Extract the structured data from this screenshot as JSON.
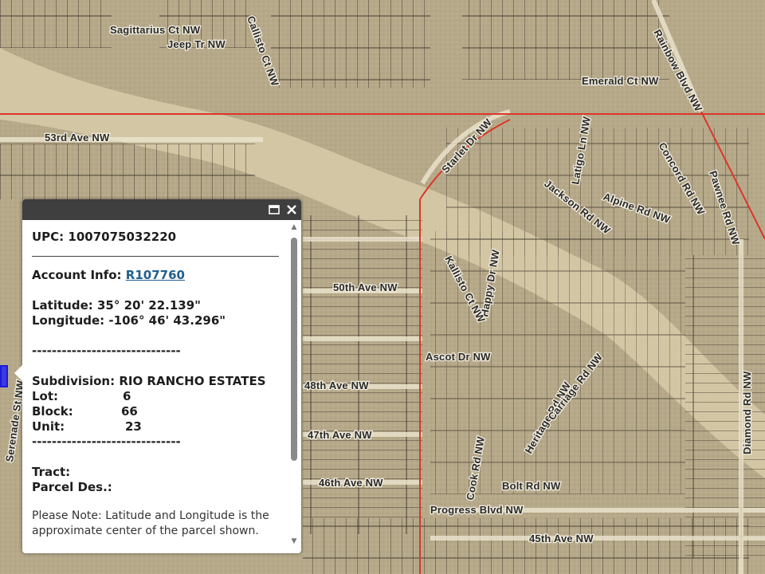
{
  "map": {
    "road_labels": [
      "Sagittarius Ct NW",
      "Jeep Tr NW",
      "Callisto Ct NW",
      "Emerald Ct NW",
      "Rainbow Blvd NW",
      "53rd Ave NW",
      "Starlet Dr NW",
      "Latigo Ln NW",
      "Jackson Rd NW",
      "Alpine Rd NW",
      "Concord Rd NW",
      "Pawnee Rd NW",
      "Happy Dr NW",
      "Kallisto Ct NW",
      "Ascot Dr NW",
      "50th Ave NW",
      "48th Ave NW",
      "47th Ave NW",
      "46th Ave NW",
      "45th Ave NW",
      "Progress Blvd NW",
      "Bolt Rd NW",
      "Cook Rd NW",
      "Diamond Rd NW",
      "Serenade St NW",
      "Heritage Rd NW",
      "Carriage Rd NW"
    ],
    "colors": {
      "aerial": "#b6a98a",
      "parcel_lines": "#3b342a",
      "boundary": "#d9372a",
      "arroyo": "#d8cba8"
    }
  },
  "popup": {
    "upc_label": "UPC:",
    "upc_value": "1007075032220",
    "account_label": "Account Info:",
    "account_link": "R107760",
    "latitude_label": "Latitude:",
    "latitude_value": "35° 20' 22.139\"",
    "longitude_label": "Longitude:",
    "longitude_value": "-106° 46' 43.296\"",
    "divider": "------------------------------",
    "subdivision_label": "Subdivision:",
    "subdivision_value": "RIO RANCHO ESTATES",
    "lot_label": "Lot:",
    "lot_value": "6",
    "block_label": "Block:",
    "block_value": "66",
    "unit_label": "Unit:",
    "unit_value": "23",
    "divider2": "------------------------------",
    "tract_label": "Tract:",
    "parcel_des_label": "Parcel Des.:",
    "note": "Please Note: Latitude and Longitude is the approximate center of the parcel shown.",
    "maximize_icon": "maximize-icon",
    "close_icon": "close-icon"
  }
}
